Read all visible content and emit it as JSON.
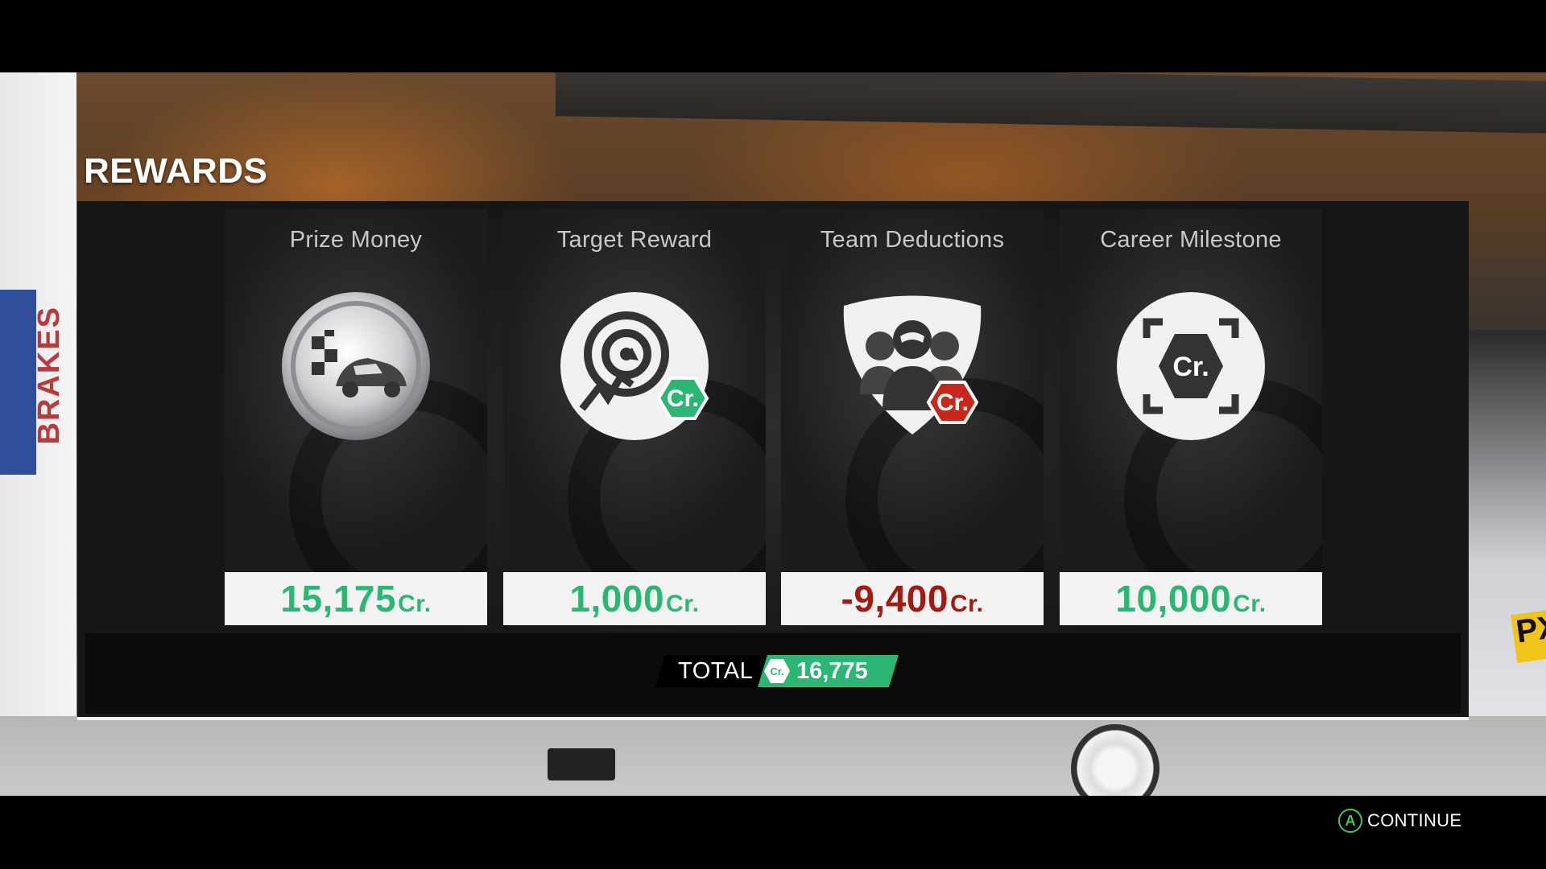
{
  "screen": {
    "title": "REWARDS"
  },
  "rewards": [
    {
      "label": "Prize Money",
      "value": "15,175",
      "unit": "Cr.",
      "icon": "prize-money-icon",
      "tone": "positive"
    },
    {
      "label": "Target Reward",
      "value": "1,000",
      "unit": "Cr.",
      "icon": "target-reward-icon",
      "tone": "positive"
    },
    {
      "label": "Team Deductions",
      "value": "-9,400",
      "unit": "Cr.",
      "icon": "team-deductions-icon",
      "tone": "negative"
    },
    {
      "label": "Career Milestone",
      "value": "10,000",
      "unit": "Cr.",
      "icon": "career-milestone-icon",
      "tone": "positive"
    }
  ],
  "total": {
    "label": "TOTAL",
    "badge": "Cr.",
    "value": "16,775"
  },
  "continue": {
    "button_glyph": "A",
    "label": "CONTINUE"
  },
  "background": {
    "banner_text": "BRAKES",
    "plate_text": "PX"
  },
  "colors": {
    "positive": "#2bb673",
    "negative": "#a01c12",
    "panel": "#1c1c1e",
    "value_box": "#f2f2f3",
    "continue_button": "#4cc25c"
  }
}
